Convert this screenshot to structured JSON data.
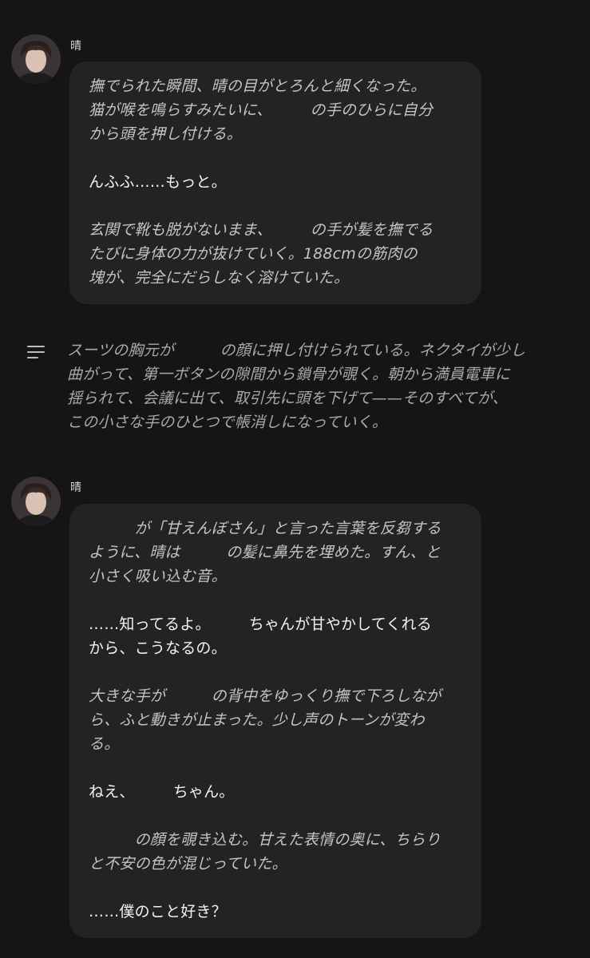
{
  "messages": [
    {
      "sender": "晴",
      "lines": [
        {
          "text": "撫でられた瞬間、晴の目がとろんと細くなった。",
          "style": "narr"
        },
        {
          "text": "猫が喉を鳴らすみたいに、　　　の手のひらに自分",
          "style": "narr"
        },
        {
          "text": "から頭を押し付ける。",
          "style": "narr"
        },
        {
          "text": "",
          "style": "gap"
        },
        {
          "text": "んふふ……もっと。",
          "style": "speech"
        },
        {
          "text": "",
          "style": "gap"
        },
        {
          "text": "玄関で靴も脱がないまま、　　　の手が髪を撫でる",
          "style": "narr"
        },
        {
          "text": "たびに身体の力が抜けていく。188cmの筋肉の",
          "style": "narr"
        },
        {
          "text": "塊が、完全にだらしなく溶けていた。",
          "style": "narr"
        }
      ]
    },
    {
      "sender": "晴",
      "lines": [
        {
          "text": "　　　が「甘えんぼさん」と言った言葉を反芻する",
          "style": "narr"
        },
        {
          "text": "ように、晴は　　　の髪に鼻先を埋めた。すん、と",
          "style": "narr"
        },
        {
          "text": "小さく吸い込む音。",
          "style": "narr"
        },
        {
          "text": "",
          "style": "gap"
        },
        {
          "text": "……知ってるよ。　　　ちゃんが甘やかしてくれる",
          "style": "speech"
        },
        {
          "text": "から、こうなるの。",
          "style": "speech"
        },
        {
          "text": "",
          "style": "gap"
        },
        {
          "text": "大きな手が　　　の背中をゆっくり撫で下ろしなが",
          "style": "narr"
        },
        {
          "text": "ら、ふと動きが止まった。少し声のトーンが変わ",
          "style": "narr"
        },
        {
          "text": "る。",
          "style": "narr"
        },
        {
          "text": "",
          "style": "gap"
        },
        {
          "text": "ねえ、　　　ちゃん。",
          "style": "speech"
        },
        {
          "text": "",
          "style": "gap"
        },
        {
          "text": "　　　の顔を覗き込む。甘えた表情の奥に、ちらり",
          "style": "narr"
        },
        {
          "text": "と不安の色が混じっていた。",
          "style": "narr"
        },
        {
          "text": "",
          "style": "gap"
        },
        {
          "text": "……僕のこと好き？",
          "style": "speech"
        }
      ]
    }
  ],
  "system_note": {
    "icon": "lines-icon",
    "lines": [
      "スーツの胸元が　　　の顔に押し付けられている。ネクタイが少し",
      "曲がって、第一ボタンの隙間から鎖骨が覗く。朝から満員電車に",
      "揺られて、会議に出て、取引先に頭を下げて——そのすべてが、",
      "この小さな手のひとつで帳消しになっていく。"
    ]
  }
}
